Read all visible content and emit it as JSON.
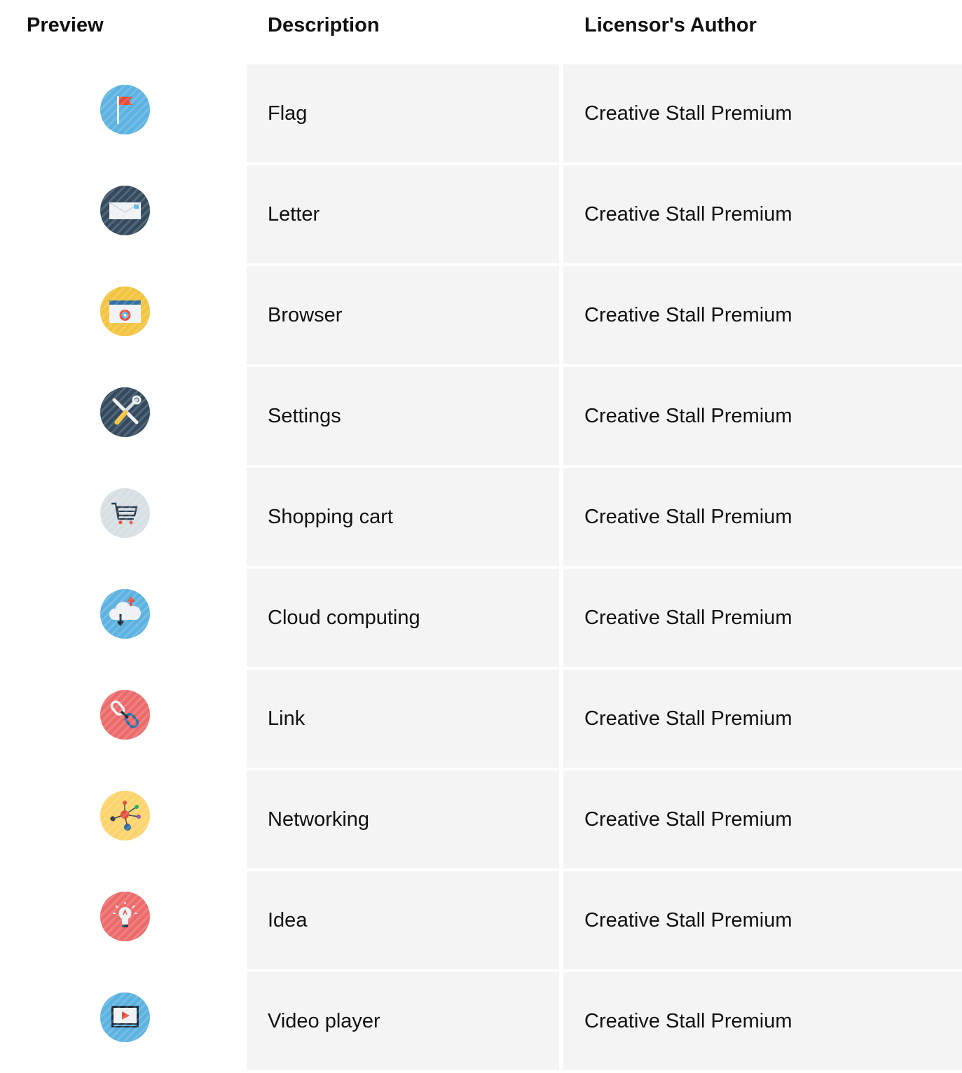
{
  "header": {
    "preview": "Preview",
    "description": "Description",
    "author": "Licensor's Author"
  },
  "rows": [
    {
      "icon": "flag-icon",
      "description": "Flag",
      "author": "Creative Stall Premium",
      "color": "#5cb2e0"
    },
    {
      "icon": "letter-icon",
      "description": "Letter",
      "author": "Creative Stall Premium",
      "color": "#344a5e"
    },
    {
      "icon": "browser-icon",
      "description": "Browser",
      "author": "Creative Stall Premium",
      "color": "#f3c43f"
    },
    {
      "icon": "settings-icon",
      "description": "Settings",
      "author": "Creative Stall Premium",
      "color": "#344a5e"
    },
    {
      "icon": "shopping-cart-icon",
      "description": "Shopping cart",
      "author": "Creative Stall Premium",
      "color": "#d7dfe3"
    },
    {
      "icon": "cloud-computing-icon",
      "description": "Cloud computing",
      "author": "Creative Stall Premium",
      "color": "#5cb2e0"
    },
    {
      "icon": "link-icon",
      "description": "Link",
      "author": "Creative Stall Premium",
      "color": "#ec6a6a"
    },
    {
      "icon": "networking-icon",
      "description": "Networking",
      "author": "Creative Stall Premium",
      "color": "#fdd36b"
    },
    {
      "icon": "idea-icon",
      "description": "Idea",
      "author": "Creative Stall Premium",
      "color": "#ec6a6a"
    },
    {
      "icon": "video-player-icon",
      "description": "Video player",
      "author": "Creative Stall Premium",
      "color": "#5cb2e0"
    }
  ]
}
